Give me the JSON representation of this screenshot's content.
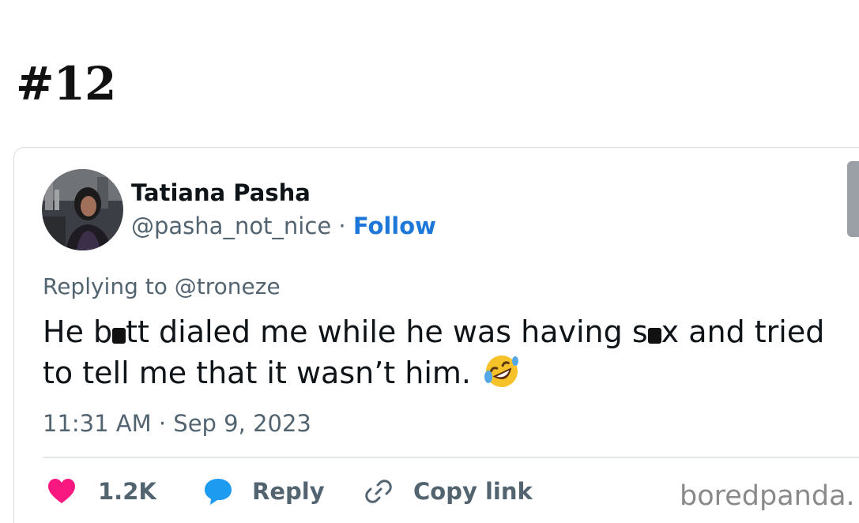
{
  "page": {
    "title": "#12"
  },
  "tweet": {
    "author_name": "Tatiana Pasha",
    "handle": "@pasha_not_nice",
    "separator": " · ",
    "follow_label": "Follow",
    "reply_prefix": "Replying to ",
    "reply_to": "@troneze",
    "text_parts": [
      "He b",
      "tt dialed me while he was having s",
      "x and tried to tell me that it wasn’t him. "
    ],
    "emoji": "rolling-on-floor-laughing-emoji",
    "timestamp": "11:31 AM · Sep 9, 2023",
    "actions": {
      "likes": "1.2K",
      "reply_label": "Reply",
      "copy_label": "Copy link"
    }
  },
  "watermark": "boredpanda.",
  "colors": {
    "accent_link": "#1d77d8",
    "like_heart": "#f91880",
    "reply_bubble": "#1d9bf0",
    "secondary_text": "#536471"
  }
}
